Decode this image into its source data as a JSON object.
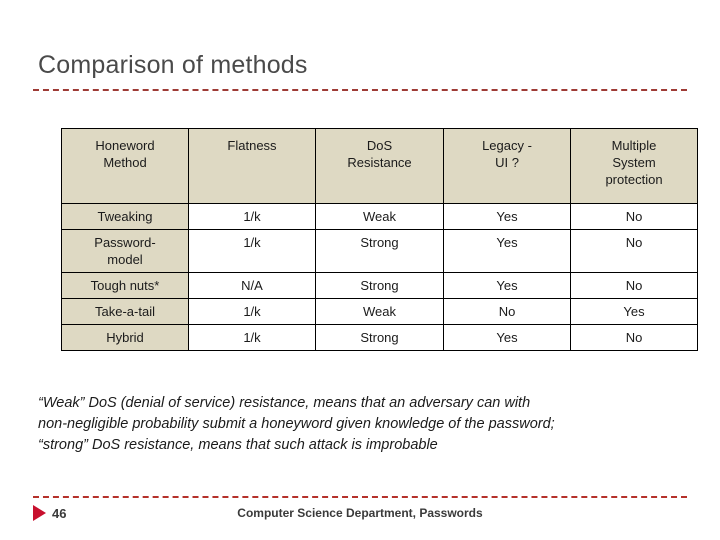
{
  "slide": {
    "title": "Comparison of methods",
    "accent_rule_color": "#9e3b35",
    "footer_rule_color": "#b5312a",
    "marker_color": "#c8102e",
    "header_fill": "#ded9c3"
  },
  "table": {
    "headers": [
      "Honeword Method",
      "Flatness",
      "DoS Resistance",
      "Legacy - UI ?",
      "Multiple System protection"
    ],
    "header_lines": [
      [
        "Honeword",
        "Method"
      ],
      [
        "Flatness"
      ],
      [
        "DoS",
        "Resistance"
      ],
      [
        "Legacy -",
        "UI ?"
      ],
      [
        "Multiple",
        "System",
        "protection"
      ]
    ],
    "rows": [
      {
        "method_lines": [
          "Tweaking"
        ],
        "method": "Tweaking",
        "flatness": "1/k",
        "dos_resistance": "Weak",
        "legacy_ui": "Yes",
        "multiple_system": "No"
      },
      {
        "method_lines": [
          "Password-",
          "model"
        ],
        "method": "Password-model",
        "flatness": "1/k",
        "dos_resistance": "Strong",
        "legacy_ui": "Yes",
        "multiple_system": "No"
      },
      {
        "method_lines": [
          "Tough nuts*"
        ],
        "method": "Tough nuts*",
        "flatness": "N/A",
        "dos_resistance": "Strong",
        "legacy_ui": "Yes",
        "multiple_system": "No"
      },
      {
        "method_lines": [
          "Take-a-tail"
        ],
        "method": "Take-a-tail",
        "flatness": "1/k",
        "dos_resistance": "Weak",
        "legacy_ui": "No",
        "multiple_system": "Yes"
      },
      {
        "method_lines": [
          "Hybrid"
        ],
        "method": "Hybrid",
        "flatness": "1/k",
        "dos_resistance": "Strong",
        "legacy_ui": "Yes",
        "multiple_system": "No"
      }
    ]
  },
  "footnote": {
    "line1": "“Weak” DoS (denial of service) resistance, means that an adversary can with",
    "line2": "non-negligible probability submit a honeyword given knowledge of the password;",
    "line3": "“strong” DoS resistance, means that such attack is improbable"
  },
  "footer": {
    "page_number": "46",
    "center_text": "Computer Science Department, Passwords",
    "marker_icon": "play-triangle-icon"
  }
}
